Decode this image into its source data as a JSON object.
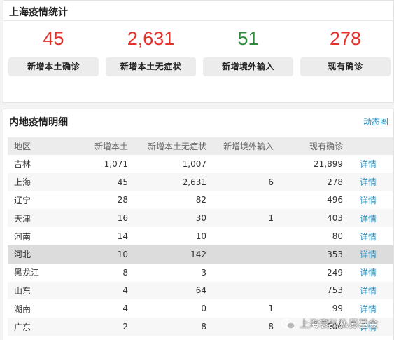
{
  "top_card": {
    "title": "上海疫情统计",
    "stats": [
      {
        "value": "45",
        "label": "新增本土确诊",
        "color": "#e4322b"
      },
      {
        "value": "2,631",
        "label": "新增本土无症状",
        "color": "#e4322b"
      },
      {
        "value": "51",
        "label": "新增境外输入",
        "color": "#2e8b3d"
      },
      {
        "value": "278",
        "label": "现有确诊",
        "color": "#e4322b"
      }
    ]
  },
  "detail_card": {
    "title": "内地疫情明细",
    "dynamic_link": "动态图",
    "columns": [
      "地区",
      "新增本土",
      "新增本土无症状",
      "新增境外输入",
      "现有确诊",
      ""
    ],
    "rows": [
      {
        "region": "吉林",
        "local": "1,071",
        "asym": "1,007",
        "imported": "",
        "current": "21,899",
        "detail": "详情"
      },
      {
        "region": "上海",
        "local": "45",
        "asym": "2,631",
        "imported": "6",
        "current": "278",
        "detail": "详情"
      },
      {
        "region": "辽宁",
        "local": "28",
        "asym": "82",
        "imported": "",
        "current": "496",
        "detail": "详情"
      },
      {
        "region": "天津",
        "local": "16",
        "asym": "30",
        "imported": "1",
        "current": "403",
        "detail": "详情"
      },
      {
        "region": "河南",
        "local": "14",
        "asym": "10",
        "imported": "",
        "current": "80",
        "detail": "详情"
      },
      {
        "region": "河北",
        "local": "10",
        "asym": "142",
        "imported": "",
        "current": "353",
        "detail": "详情"
      },
      {
        "region": "黑龙江",
        "local": "8",
        "asym": "3",
        "imported": "",
        "current": "249",
        "detail": "详情"
      },
      {
        "region": "山东",
        "local": "4",
        "asym": "64",
        "imported": "",
        "current": "753",
        "detail": "详情"
      },
      {
        "region": "湖南",
        "local": "4",
        "asym": "0",
        "imported": "1",
        "current": "99",
        "detail": "详情"
      },
      {
        "region": "广东",
        "local": "2",
        "asym": "8",
        "imported": "8",
        "current": "906",
        "detail": "详情"
      }
    ]
  },
  "watermark": {
    "text": "上海寰弘私募基金",
    "icon": "wechat-icon"
  }
}
